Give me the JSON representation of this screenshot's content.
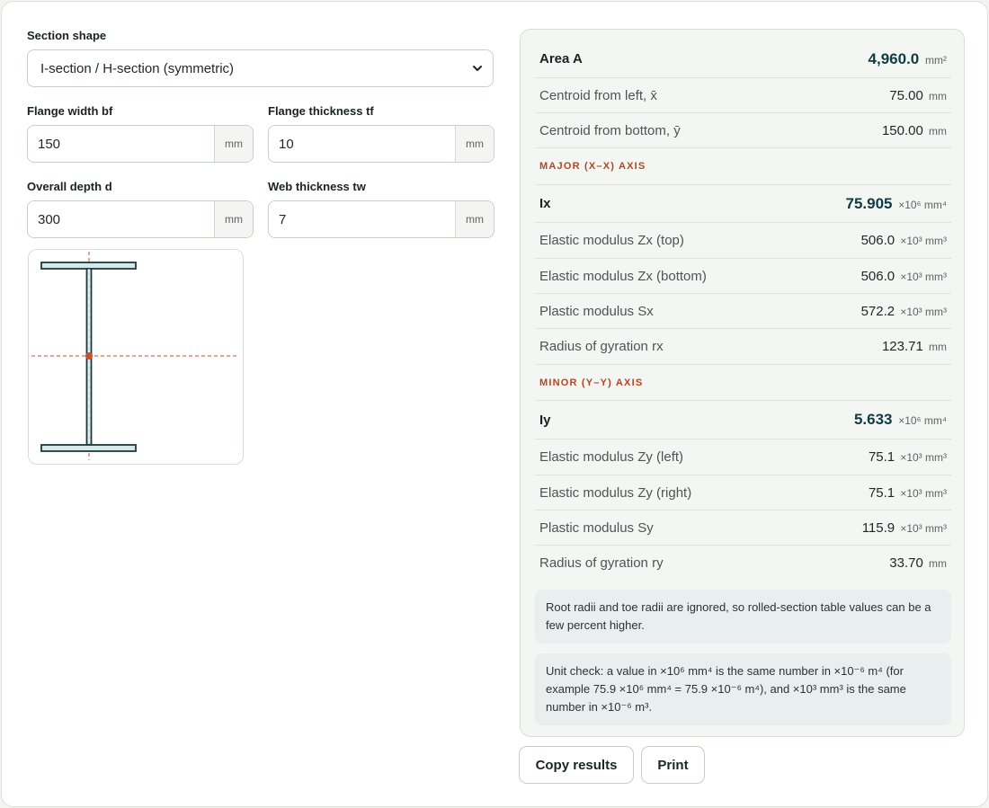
{
  "form": {
    "section_shape_label": "Section shape",
    "section_shape_value": "I-section / H-section (symmetric)",
    "fields": [
      {
        "label": "Flange width bf",
        "value": "150",
        "unit": "mm"
      },
      {
        "label": "Flange thickness tf",
        "value": "10",
        "unit": "mm"
      },
      {
        "label": "Overall depth d",
        "value": "300",
        "unit": "mm"
      },
      {
        "label": "Web thickness tw",
        "value": "7",
        "unit": "mm"
      }
    ]
  },
  "results": {
    "area": {
      "name": "Area A",
      "value": "4,960.0",
      "unit": "mm²"
    },
    "xbar": {
      "name": "Centroid from left, x̄",
      "value": "75.00",
      "unit": "mm"
    },
    "ybar": {
      "name": "Centroid from bottom, ȳ",
      "value": "150.00",
      "unit": "mm"
    },
    "major_heading": "MAJOR (X–X) AXIS",
    "ix": {
      "name": "Ix",
      "value": "75.905",
      "unit": "×10⁶ mm⁴"
    },
    "zx_top": {
      "name": "Elastic modulus Zx (top)",
      "value": "506.0",
      "unit": "×10³ mm³"
    },
    "zx_bottom": {
      "name": "Elastic modulus Zx (bottom)",
      "value": "506.0",
      "unit": "×10³ mm³"
    },
    "sx": {
      "name": "Plastic modulus Sx",
      "value": "572.2",
      "unit": "×10³ mm³"
    },
    "rx": {
      "name": "Radius of gyration rx",
      "value": "123.71",
      "unit": "mm"
    },
    "minor_heading": "MINOR (Y–Y) AXIS",
    "iy": {
      "name": "Iy",
      "value": "5.633",
      "unit": "×10⁶ mm⁴"
    },
    "zy_left": {
      "name": "Elastic modulus Zy (left)",
      "value": "75.1",
      "unit": "×10³ mm³"
    },
    "zy_right": {
      "name": "Elastic modulus Zy (right)",
      "value": "75.1",
      "unit": "×10³ mm³"
    },
    "sy": {
      "name": "Plastic modulus Sy",
      "value": "115.9",
      "unit": "×10³ mm³"
    },
    "ry": {
      "name": "Radius of gyration ry",
      "value": "33.70",
      "unit": "mm"
    }
  },
  "notes": {
    "radii": "Root radii and toe radii are ignored, so rolled-section table values can be a few percent higher.",
    "units": "Unit check: a value in ×10⁶ mm⁴ is the same number in ×10⁻⁶ m⁴ (for example 75.9 ×10⁶ mm⁴ = 75.9 ×10⁻⁶ m⁴), and ×10³ mm³ is the same number in ×10⁻⁶ m³."
  },
  "buttons": {
    "copy": "Copy results",
    "print": "Print"
  },
  "colors": {
    "accent": "#b5461f",
    "flange_fill": "#d6e8e8",
    "outline": "#1c3a3e"
  },
  "icons": {
    "select": "chevron-down-icon"
  }
}
